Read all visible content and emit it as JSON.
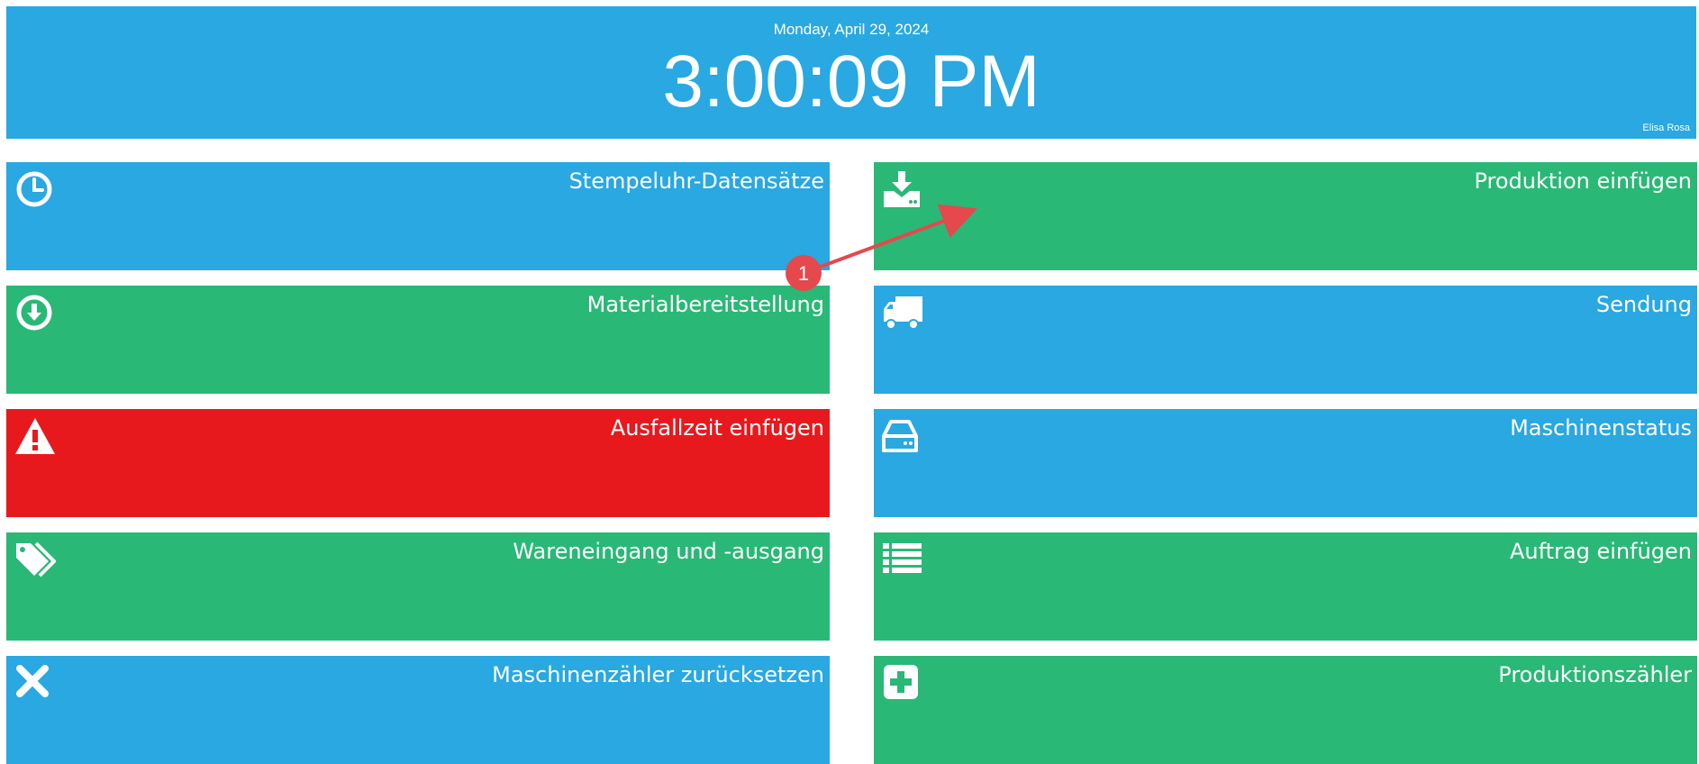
{
  "header": {
    "date": "Monday, April 29, 2024",
    "time": "3:00:09 PM",
    "user": "Elisa Rosa"
  },
  "tiles": {
    "left": [
      {
        "label": "Stempeluhr-Datensätze",
        "icon": "clock-icon",
        "color": "#29a8e2"
      },
      {
        "label": "Materialbereitstellung",
        "icon": "download-circle-icon",
        "color": "#2ab876"
      },
      {
        "label": "Ausfallzeit einfügen",
        "icon": "warning-icon",
        "color": "#e8191d"
      },
      {
        "label": "Wareneingang und -ausgang",
        "icon": "tags-icon",
        "color": "#2ab876"
      },
      {
        "label": "Maschinenzähler zurücksetzen",
        "icon": "close-icon",
        "color": "#29a8e2"
      }
    ],
    "right": [
      {
        "label": "Produktion einfügen",
        "icon": "download-tray-icon",
        "color": "#2ab876"
      },
      {
        "label": "Sendung",
        "icon": "truck-icon",
        "color": "#29a8e2"
      },
      {
        "label": "Maschinenstatus",
        "icon": "hdd-icon",
        "color": "#29a8e2"
      },
      {
        "label": "Auftrag einfügen",
        "icon": "list-icon",
        "color": "#2ab876"
      },
      {
        "label": "Produktionszähler",
        "icon": "plus-square-icon",
        "color": "#2ab876"
      }
    ]
  },
  "annotation": {
    "badge_number": "1",
    "color": "#e5484d"
  }
}
